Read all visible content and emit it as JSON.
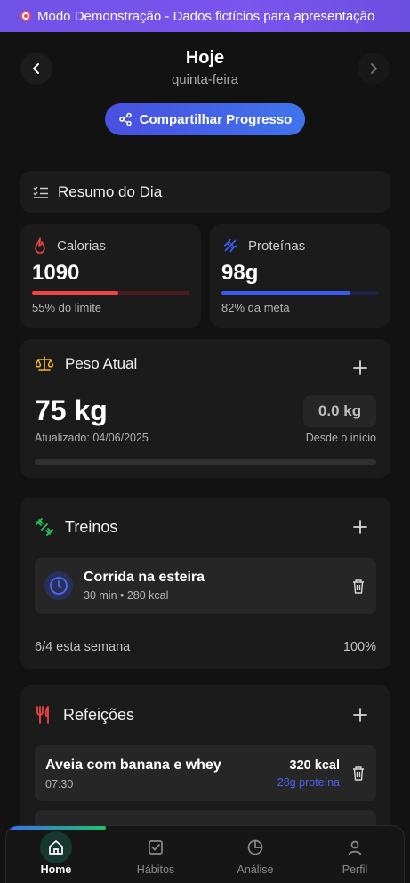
{
  "banner": {
    "text": "Modo Demonstração - Dados fictícios para apresentação"
  },
  "header": {
    "title": "Hoje",
    "subtitle": "quinta-feira",
    "share_label": "Compartilhar Progresso"
  },
  "summary": {
    "title": "Resumo do Dia"
  },
  "calories": {
    "label": "Calorias",
    "value": "1090",
    "footnote": "55% do limite",
    "progress": 0.55,
    "color": "#ef4444"
  },
  "protein": {
    "label": "Proteínas",
    "value": "98g",
    "footnote": "82% da meta",
    "progress": 0.82,
    "color": "#3b5bf0"
  },
  "weight": {
    "title": "Peso Atual",
    "value": "75 kg",
    "updated": "Atualizado: 04/06/2025",
    "delta": "0.0 kg",
    "delta_label": "Desde o início"
  },
  "workouts": {
    "title": "Treinos",
    "items": [
      {
        "name": "Corrida na esteira",
        "meta": "30 min • 280 kcal"
      }
    ],
    "week_summary": "6/4 esta semana",
    "week_percent": "100%"
  },
  "meals": {
    "title": "Refeições",
    "items": [
      {
        "name": "Aveia com banana e whey",
        "time": "07:30",
        "kcal": "320 kcal",
        "protein": "28g proteína"
      }
    ]
  },
  "nav": {
    "tabs": [
      {
        "label": "Home",
        "icon": "home-icon",
        "active": true
      },
      {
        "label": "Hábitos",
        "icon": "checkbox-icon",
        "active": false
      },
      {
        "label": "Análise",
        "icon": "pie-chart-icon",
        "active": false
      },
      {
        "label": "Perfil",
        "icon": "user-icon",
        "active": false
      }
    ],
    "top_progress": 0.25
  },
  "colors": {
    "accent_green": "#22c55e",
    "accent_blue": "#3b5bf0",
    "accent_red": "#ef4444",
    "accent_yellow": "#f5b82e"
  }
}
